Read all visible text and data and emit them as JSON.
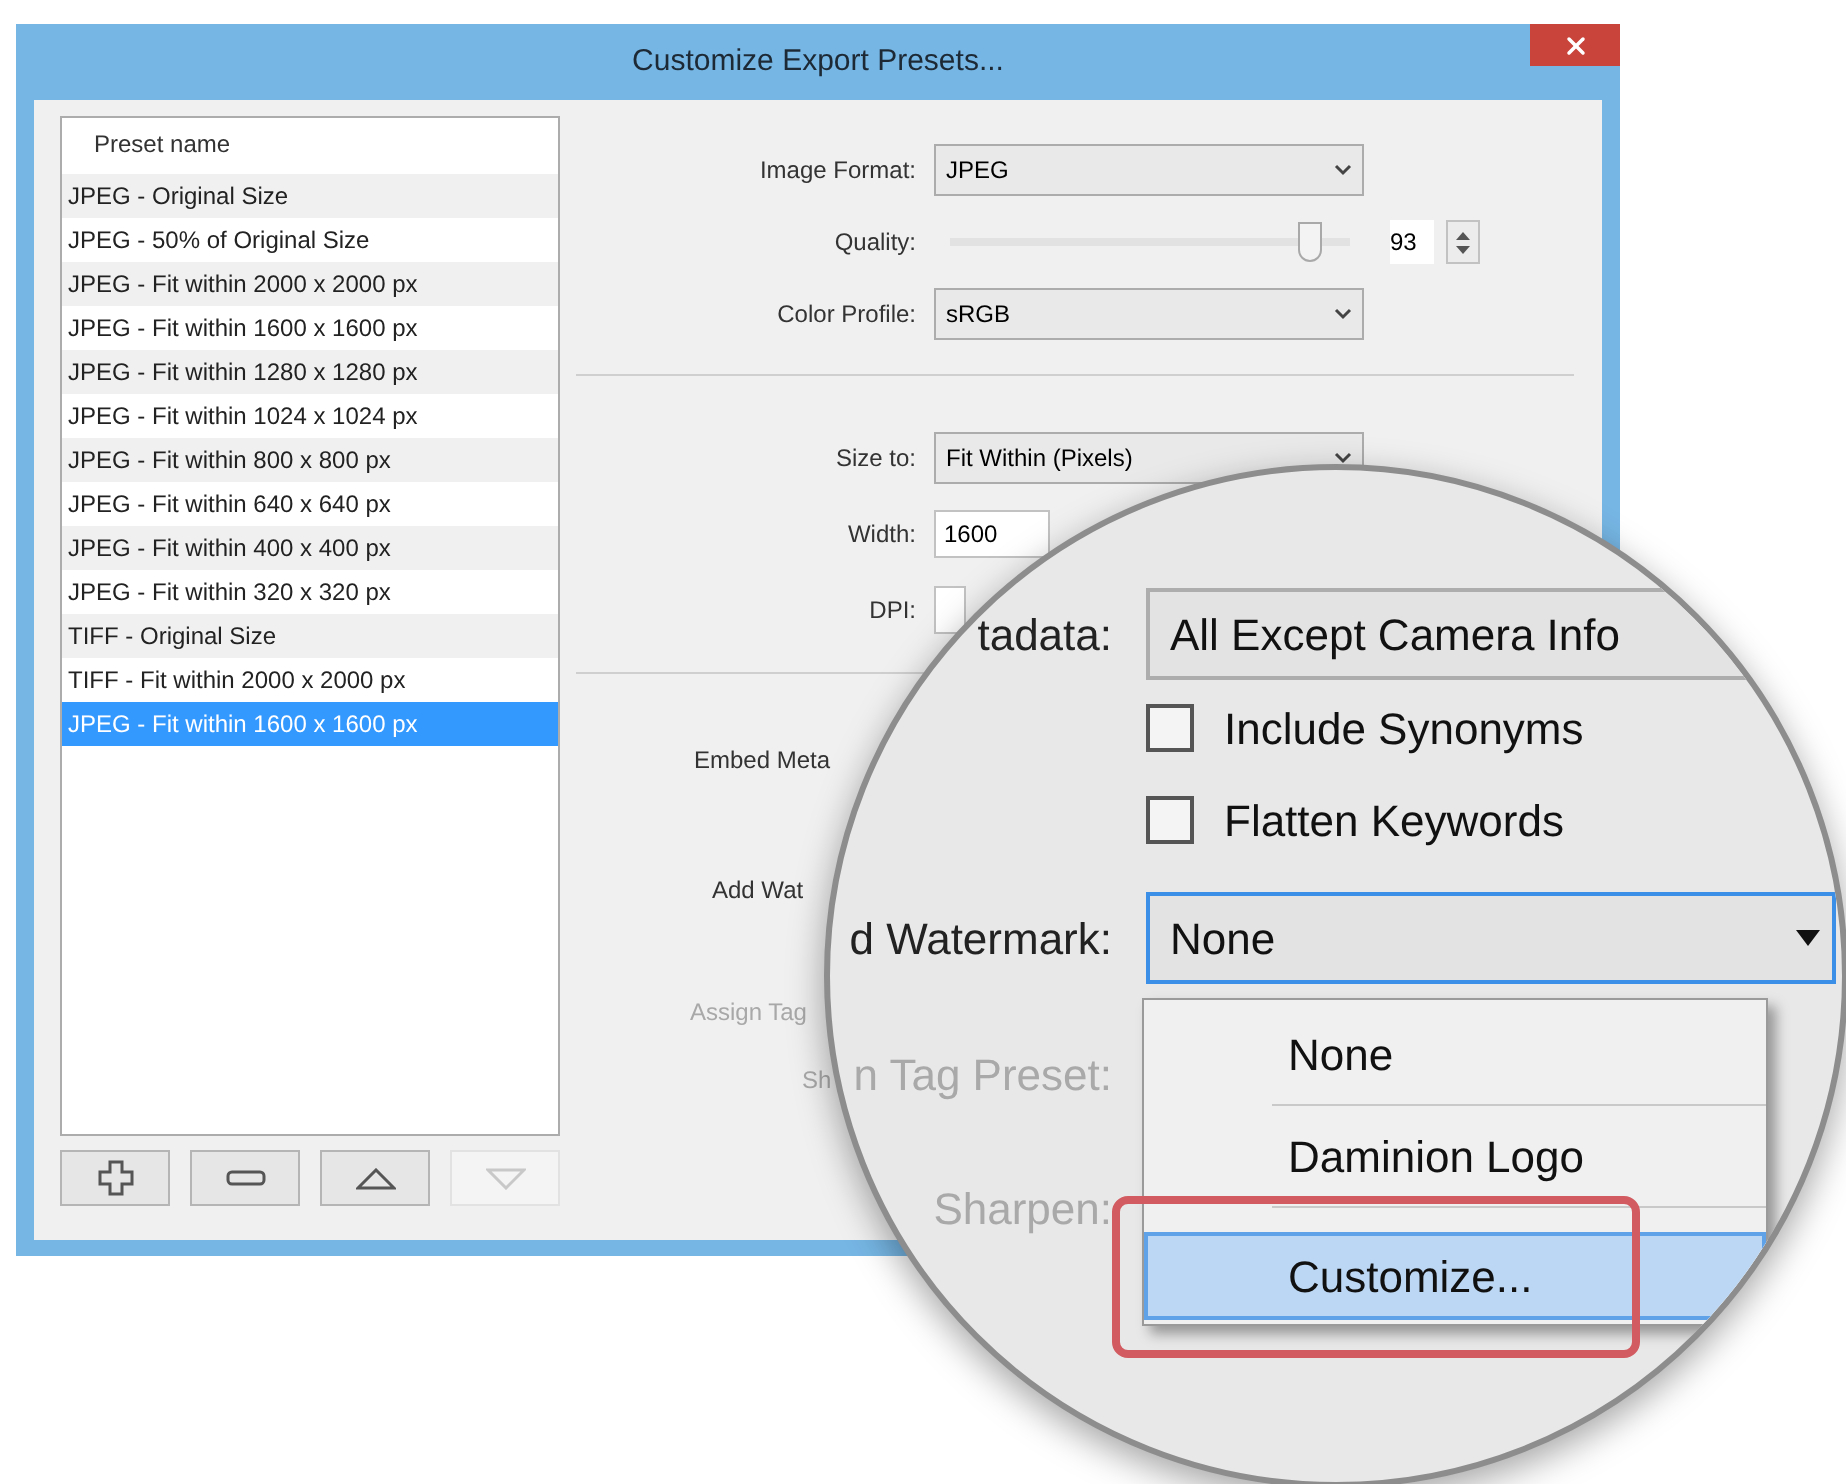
{
  "window": {
    "title": "Customize Export Presets..."
  },
  "preset_list": {
    "header": "Preset name",
    "items": [
      {
        "label": "JPEG - Original Size",
        "selected": false
      },
      {
        "label": "JPEG - 50% of Original Size",
        "selected": false
      },
      {
        "label": "JPEG - Fit within 2000 x 2000 px",
        "selected": false
      },
      {
        "label": "JPEG - Fit within 1600 x 1600 px",
        "selected": false
      },
      {
        "label": "JPEG - Fit within 1280 x 1280 px",
        "selected": false
      },
      {
        "label": "JPEG - Fit within 1024 x 1024 px",
        "selected": false
      },
      {
        "label": "JPEG - Fit within 800 x 800 px",
        "selected": false
      },
      {
        "label": "JPEG - Fit within 640 x 640 px",
        "selected": false
      },
      {
        "label": "JPEG - Fit within 400 x 400 px",
        "selected": false
      },
      {
        "label": "JPEG - Fit within 320 x 320 px",
        "selected": false
      },
      {
        "label": "TIFF - Original Size",
        "selected": false
      },
      {
        "label": "TIFF - Fit within 2000 x 2000 px",
        "selected": false
      },
      {
        "label": "JPEG - Fit within 1600 x 1600 px",
        "selected": true
      }
    ],
    "buttons": [
      {
        "kind": "add",
        "disabled": false
      },
      {
        "kind": "remove",
        "disabled": false
      },
      {
        "kind": "up",
        "disabled": false
      },
      {
        "kind": "down",
        "disabled": true
      }
    ]
  },
  "settings": [
    [
      {
        "kind": "select",
        "label": "Image Format:",
        "value": "JPEG"
      },
      {
        "kind": "slider",
        "label": "Quality:",
        "level": 0.9,
        "value": "93"
      },
      {
        "kind": "select",
        "label": "Color Profile:",
        "value": "sRGB"
      }
    ],
    [
      {
        "kind": "select",
        "label": "Size to:",
        "value": "Fit Within (Pixels)"
      },
      {
        "kind": "text",
        "label": "Width:",
        "value": "1600"
      },
      {
        "kind": "text",
        "label": "DPI:"
      }
    ],
    [
      {
        "kind": "label",
        "label": "Embed Meta",
        "disabled": false
      },
      {
        "kind": "label",
        "label": "Add Wat",
        "disabled": false
      },
      {
        "kind": "label",
        "label": "Assign Tag",
        "disabled": true
      },
      {
        "kind": "label",
        "label": "Sh",
        "disabled": true
      }
    ]
  ],
  "magnifier": {
    "rows": [
      {
        "kind": "select",
        "label": "tadata:",
        "value": "All Except Camera Info",
        "focused": false
      },
      {
        "kind": "checkbox",
        "label": "Include Synonyms",
        "checked": false
      },
      {
        "kind": "checkbox",
        "label": "Flatten Keywords",
        "checked": false
      },
      {
        "kind": "select",
        "label": "d Watermark:",
        "value": "None",
        "focused": true
      }
    ],
    "side_labels": [
      {
        "label": "n Tag Preset:",
        "disabled": true
      },
      {
        "label": "Sharpen:",
        "disabled": true
      }
    ],
    "menu": [
      {
        "label": "None",
        "selected": false
      },
      {
        "label": "Daminion Logo",
        "selected": false
      },
      {
        "label": "Customize...",
        "selected": true
      }
    ]
  }
}
